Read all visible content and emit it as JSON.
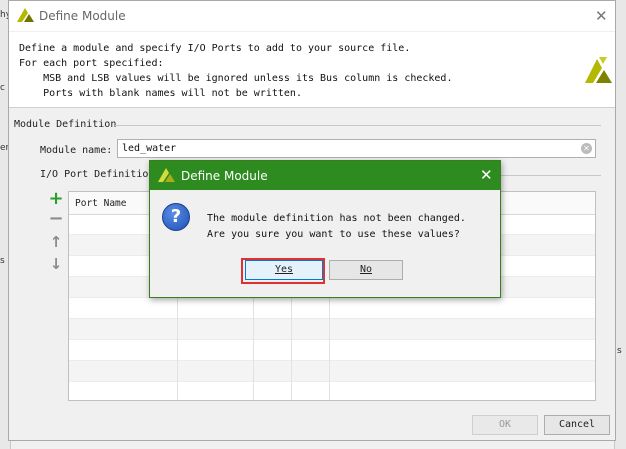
{
  "background": {
    "fragments": [
      "hy",
      "c",
      "em",
      "s",
      "s"
    ]
  },
  "window": {
    "title": "Define Module",
    "close_glyph": "✕",
    "description": [
      "Define a module and specify I/O Ports to add to your source file.",
      "For each port specified:",
      "    MSB and LSB values will be ignored unless its Bus column is checked.",
      "    Ports with blank names will not be written."
    ],
    "module_definition_label": "Module Definition",
    "module_name_label": "Module name:",
    "module_name_value": "led_water",
    "io_ports_label": "I/O Port Definitio",
    "table": {
      "columns": [
        "Port Name"
      ]
    },
    "toolbar": {
      "add_glyph": "+",
      "remove_glyph": "−",
      "up_glyph": "↑",
      "down_glyph": "↓"
    },
    "ok_label": "OK",
    "cancel_label": "Cancel"
  },
  "modal": {
    "title": "Define Module",
    "close_glyph": "✕",
    "icon_glyph": "?",
    "message_line1": "The module definition has not been changed.",
    "message_line2": "Are you sure you want to use these values?",
    "yes_label": "Yes",
    "no_label": "No"
  },
  "colors": {
    "modal_title_bg": "#2e8b1f",
    "highlight": "#e03030",
    "brand": "#b3b800"
  }
}
